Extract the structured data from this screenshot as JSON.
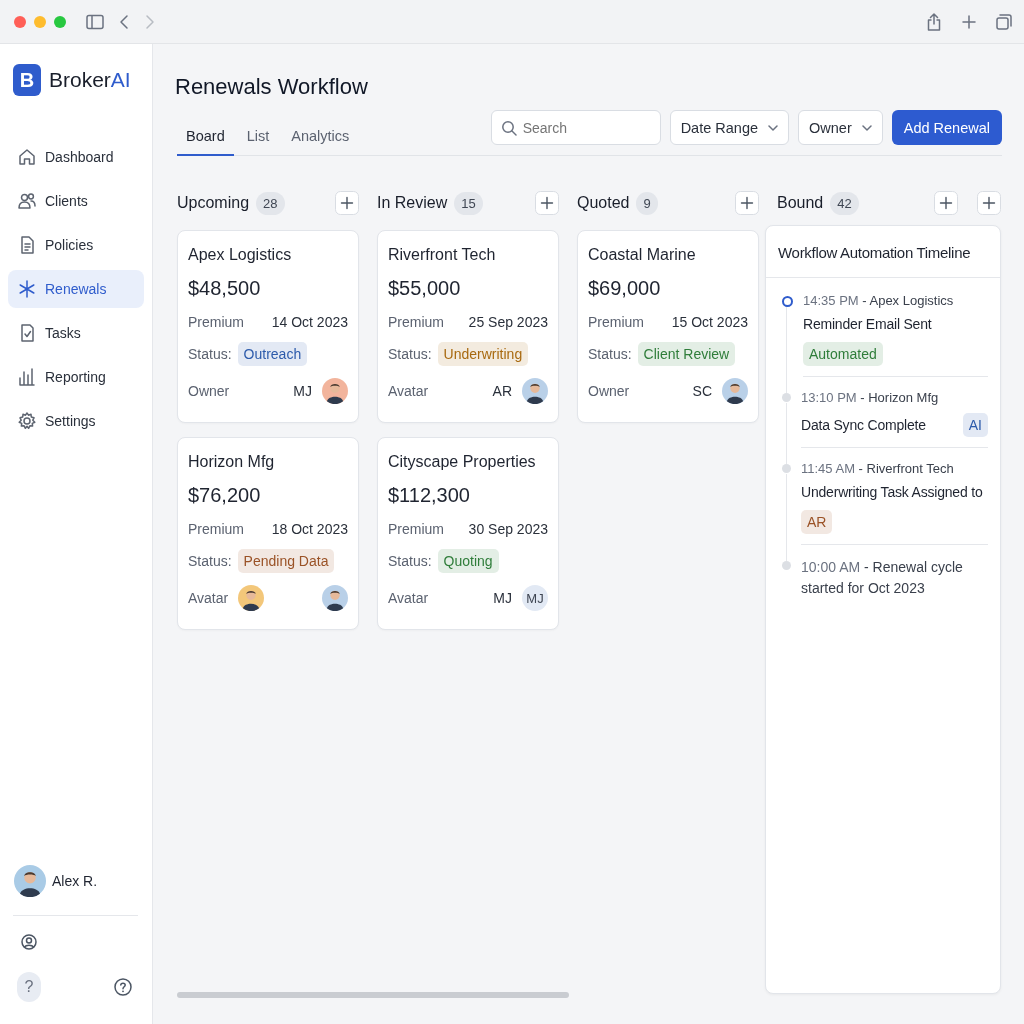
{
  "app": {
    "logo_letter": "B",
    "name_main": "Broker",
    "name_accent": "AI"
  },
  "sidebar": {
    "items": [
      {
        "label": "Dashboard",
        "selected": false
      },
      {
        "label": "Clients",
        "selected": false
      },
      {
        "label": "Policies",
        "selected": false
      },
      {
        "label": "Renewals",
        "selected": true
      },
      {
        "label": "Tasks",
        "selected": false
      },
      {
        "label": "Reporting",
        "selected": false
      },
      {
        "label": "Settings",
        "selected": false
      }
    ],
    "user": {
      "name": "Alex R."
    },
    "help_label": "?"
  },
  "page": {
    "title": "Renewals Workflow",
    "tabs": [
      {
        "label": "Board",
        "selected": true
      },
      {
        "label": "List",
        "selected": false
      },
      {
        "label": "Analytics",
        "selected": false
      }
    ],
    "search": {
      "placeholder": "Search"
    },
    "filters": [
      "Date Range",
      "Owner"
    ],
    "primary_button": "Add Renewal"
  },
  "columns": [
    {
      "title": "Upcoming",
      "count": "28",
      "cards": [
        {
          "name": "Apex Logistics",
          "amount": "$48,500",
          "premium_label": "Premium",
          "date": "14 Oct 2023",
          "status_label": "Status:",
          "status": "Outreach",
          "color": "#2d5bab",
          "owner_row": [
            {
              "kind": "label",
              "text": "Owner"
            },
            {
              "kind": "spacer"
            },
            {
              "kind": "initials",
              "text": "MJ"
            },
            {
              "kind": "photo",
              "color": "#f2b49c"
            }
          ]
        },
        {
          "name": "Horizon Mfg",
          "amount": "$76,200",
          "premium_label": "Premium",
          "date": "18 Oct 2023",
          "status_label": "Status:",
          "status": "Pending Data",
          "color": "#9a5226",
          "owner_row": [
            {
              "kind": "label",
              "text": "Avatar"
            },
            {
              "kind": "photo",
              "color": "#f3c77a"
            },
            {
              "kind": "spacer"
            },
            {
              "kind": "photo",
              "color": "#b9d0e8"
            }
          ]
        }
      ]
    },
    {
      "title": "In Review",
      "count": "15",
      "cards": [
        {
          "name": "Riverfront Tech",
          "amount": "$55,000",
          "premium_label": "Premium",
          "date": "25 Sep 2023",
          "status_label": "Status:",
          "status": "Underwriting",
          "color": "#a8690f",
          "owner_row": [
            {
              "kind": "label",
              "text": "Avatar"
            },
            {
              "kind": "spacer"
            },
            {
              "kind": "initials",
              "text": "AR"
            },
            {
              "kind": "photo",
              "color": "#b9d0e8"
            }
          ]
        },
        {
          "name": "Cityscape Properties",
          "amount": "$112,300",
          "premium_label": "Premium",
          "date": "30 Sep 2023",
          "status_label": "Status:",
          "status": "Quoting",
          "color": "#2f7d3a",
          "owner_row": [
            {
              "kind": "label",
              "text": "Avatar"
            },
            {
              "kind": "spacer"
            },
            {
              "kind": "initials",
              "text": "MJ"
            },
            {
              "kind": "initials-avatar",
              "text": "MJ"
            }
          ]
        }
      ]
    },
    {
      "title": "Quoted",
      "count": "9",
      "cards": [
        {
          "name": "Coastal Marine",
          "amount": "$69,000",
          "premium_label": "Premium",
          "date": "15 Oct 2023",
          "status_label": "Status:",
          "status": "Client Review",
          "color": "#2f7d3a",
          "owner_row": [
            {
              "kind": "label",
              "text": "Owner"
            },
            {
              "kind": "spacer"
            },
            {
              "kind": "initials",
              "text": "SC"
            },
            {
              "kind": "photo",
              "color": "#b9d0e8"
            }
          ]
        }
      ]
    }
  ],
  "bound": {
    "title": "Bound",
    "count": "42"
  },
  "timeline": {
    "title": "Workflow Automation Timeline",
    "events": [
      {
        "active": true,
        "time": "14:35 PM",
        "source": "- Apex Logistics",
        "title": "Reminder Email Sent",
        "tag": {
          "text": "Automated",
          "color": "#2f7d3a"
        }
      },
      {
        "active": false,
        "time": "13:10 PM",
        "source": "- Horizon Mfg",
        "title": "Data Sync Complete",
        "badge": {
          "text": "AI",
          "color": "#2d5bab"
        }
      },
      {
        "active": false,
        "time": "11:45 AM",
        "source": "- Riverfront Tech",
        "title": "Underwriting Task Assigned to",
        "tag": {
          "text": "AR",
          "color": "#9a5226"
        }
      },
      {
        "active": false,
        "time": "10:00 AM",
        "source": "- Renewal cycle started for Oct 2023"
      }
    ]
  }
}
